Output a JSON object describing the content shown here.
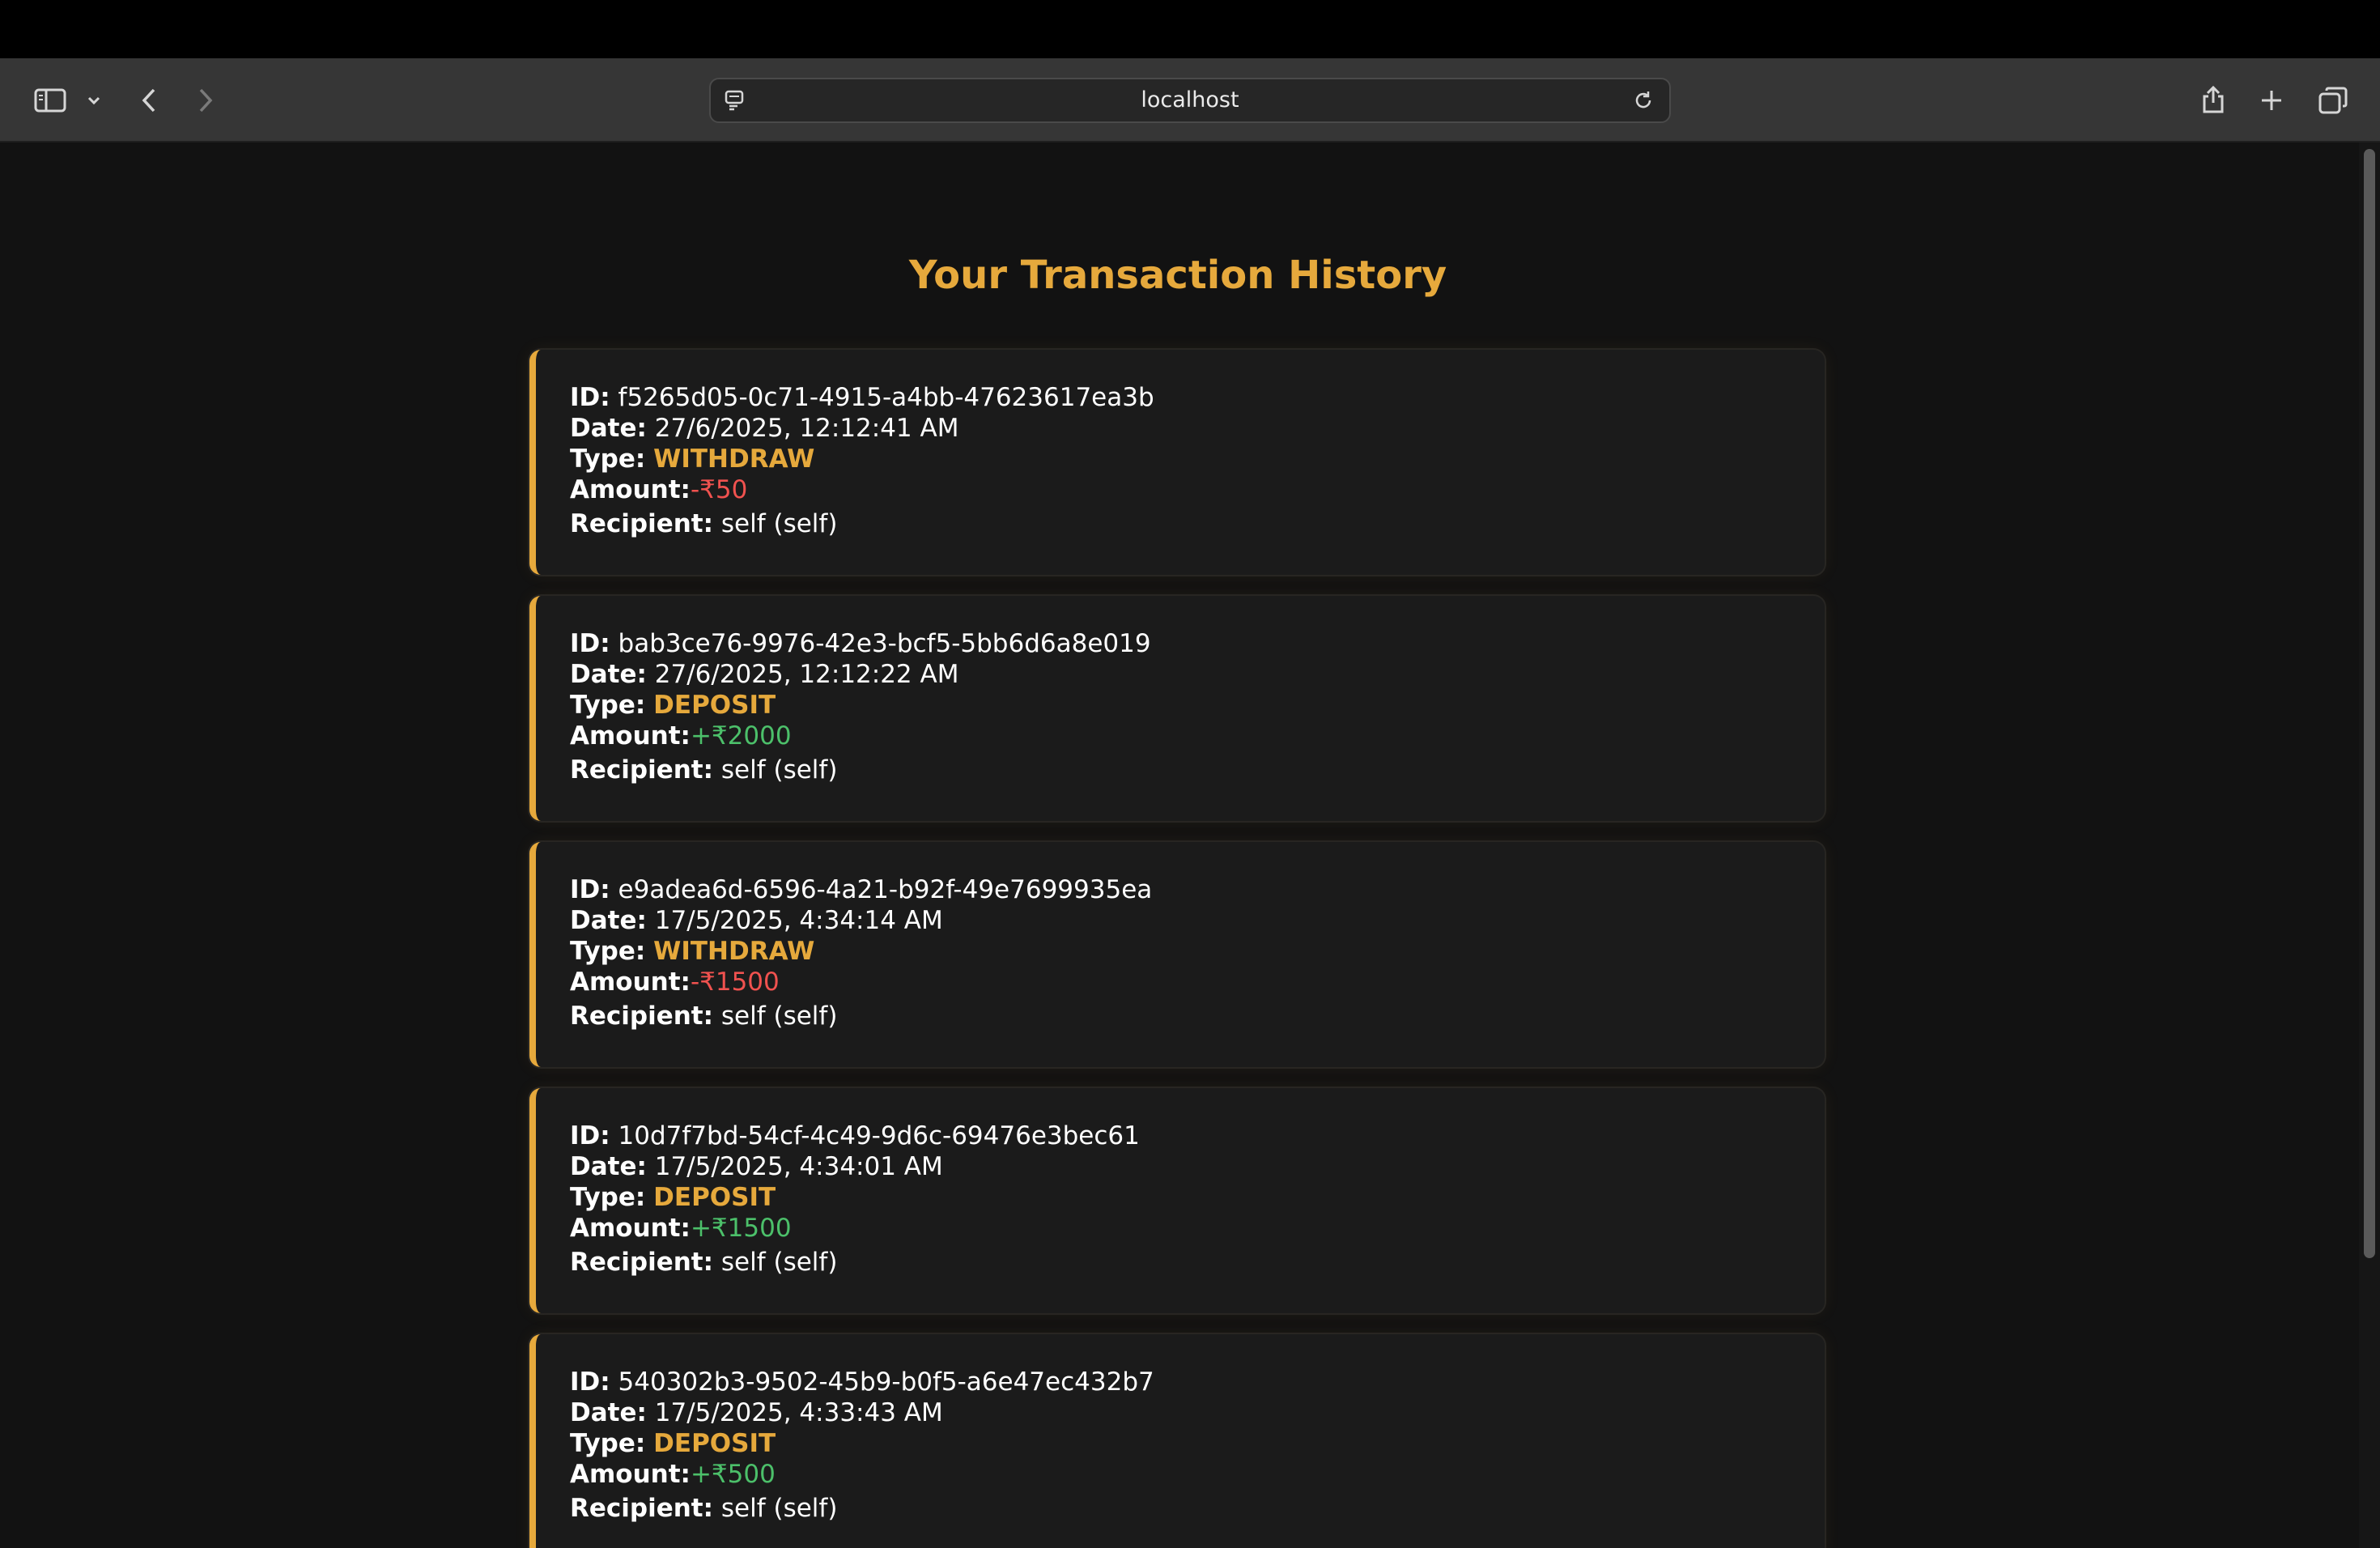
{
  "browser": {
    "url": "localhost"
  },
  "page": {
    "title": "Your Transaction History"
  },
  "labels": {
    "id": "ID:",
    "date": "Date:",
    "type": "Type:",
    "amount": "Amount:",
    "recipient": "Recipient:"
  },
  "transactions": [
    {
      "id": "f5265d05-0c71-4915-a4bb-47623617ea3b",
      "date": "27/6/2025, 12:12:41 AM",
      "type": "WITHDRAW",
      "amount": "-₹50",
      "recipient": "self (self)"
    },
    {
      "id": "bab3ce76-9976-42e3-bcf5-5bb6d6a8e019",
      "date": "27/6/2025, 12:12:22 AM",
      "type": "DEPOSIT",
      "amount": "+₹2000",
      "recipient": "self (self)"
    },
    {
      "id": "e9adea6d-6596-4a21-b92f-49e7699935ea",
      "date": "17/5/2025, 4:34:14 AM",
      "type": "WITHDRAW",
      "amount": "-₹1500",
      "recipient": "self (self)"
    },
    {
      "id": "10d7f7bd-54cf-4c49-9d6c-69476e3bec61",
      "date": "17/5/2025, 4:34:01 AM",
      "type": "DEPOSIT",
      "amount": "+₹1500",
      "recipient": "self (self)"
    },
    {
      "id": "540302b3-9502-45b9-b0f5-a6e47ec432b7",
      "date": "17/5/2025, 4:33:43 AM",
      "type": "DEPOSIT",
      "amount": "+₹500",
      "recipient": "self (self)"
    }
  ],
  "colors": {
    "accent": "#e6a93c",
    "negative": "#f0524f",
    "positive": "#4cc06a",
    "background": "#121212",
    "card": "#1b1b1b"
  }
}
